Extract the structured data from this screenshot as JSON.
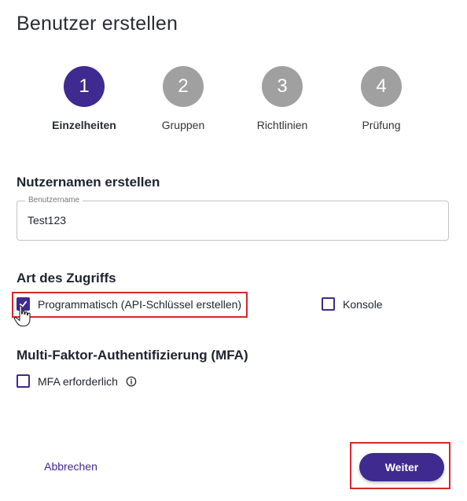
{
  "page": {
    "title": "Benutzer erstellen"
  },
  "stepper": {
    "steps": [
      {
        "number": "1",
        "label": "Einzelheiten",
        "active": true
      },
      {
        "number": "2",
        "label": "Gruppen",
        "active": false
      },
      {
        "number": "3",
        "label": "Richtlinien",
        "active": false
      },
      {
        "number": "4",
        "label": "Prüfung",
        "active": false
      }
    ]
  },
  "username_section": {
    "heading": "Nutzernamen erstellen",
    "field_label": "Benutzername",
    "field_value": "Test123"
  },
  "access_section": {
    "heading": "Art des Zugriffs",
    "programmatic_label": "Programmatisch (API-Schlüssel erstellen)",
    "programmatic_checked": true,
    "console_label": "Konsole",
    "console_checked": false
  },
  "mfa_section": {
    "heading": "Multi-Faktor-Authentifizierung (MFA)",
    "mfa_label": "MFA erforderlich",
    "mfa_checked": false,
    "info_icon": "info-icon"
  },
  "footer": {
    "cancel_label": "Abbrechen",
    "next_label": "Weiter"
  },
  "colors": {
    "accent": "#3f2a8f",
    "inactive_step": "#a0a0a0",
    "highlight": "#d9262b"
  }
}
